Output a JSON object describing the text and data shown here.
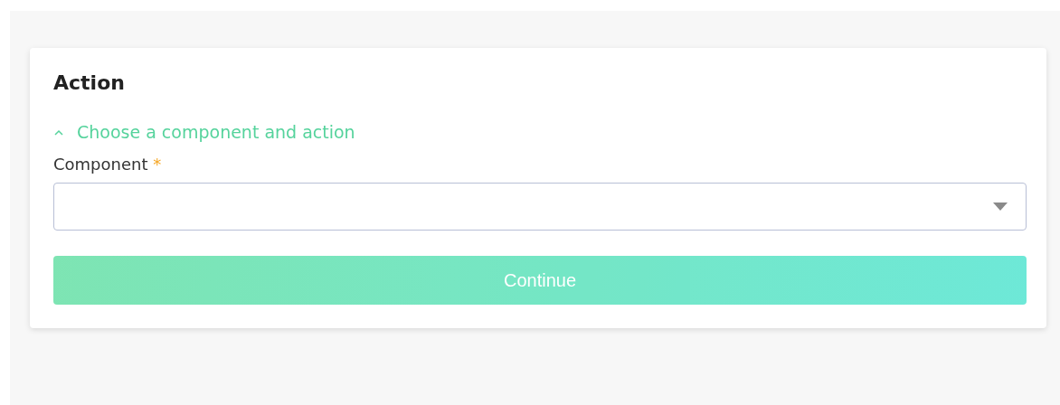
{
  "card": {
    "title": "Action",
    "section": {
      "label": "Choose a component and action",
      "expanded": true
    },
    "field": {
      "label": "Component",
      "required_mark": "*"
    },
    "button": {
      "label": "Continue",
      "disabled": true
    }
  }
}
